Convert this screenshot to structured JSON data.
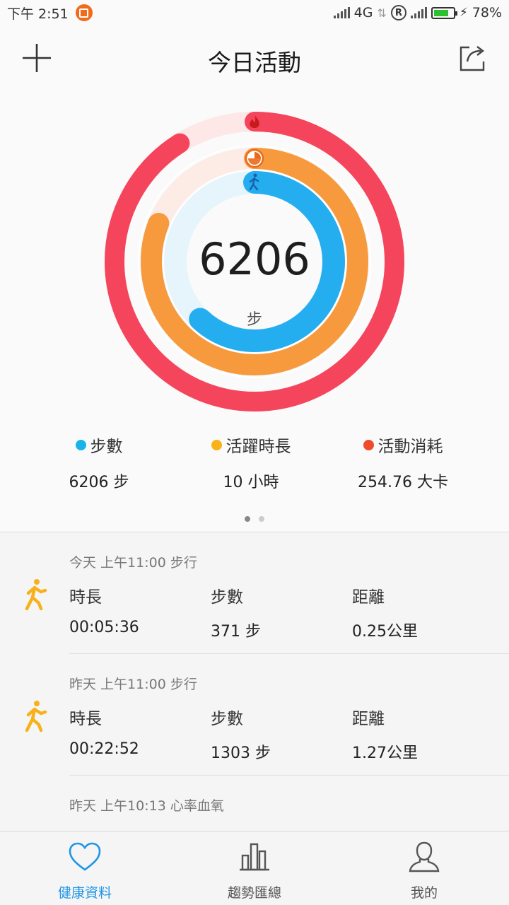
{
  "status_bar": {
    "time": "下午 2:51",
    "network": "4G",
    "battery_percent": "78%",
    "battery_level": 0.78
  },
  "header": {
    "title": "今日活動",
    "left_icon": "plus-icon",
    "right_icon": "share-icon"
  },
  "summary": {
    "center_value": "6206",
    "center_unit": "步",
    "rings": [
      {
        "name": "活動消耗",
        "color": "#f5455c",
        "progress": 0.91
      },
      {
        "name": "活躍時長",
        "color": "#f79a3e",
        "progress": 0.81
      },
      {
        "name": "步數",
        "color": "#24aef0",
        "progress": 0.62
      }
    ],
    "metrics": [
      {
        "label": "步數",
        "value": "6206  步",
        "color": "#1ab3e8"
      },
      {
        "label": "活躍時長",
        "value": "10  小時",
        "color": "#f9b218"
      },
      {
        "label": "活動消耗",
        "value": "254.76  大卡",
        "color": "#ef4c2c"
      }
    ],
    "pager": {
      "pages": 2,
      "current": 1
    }
  },
  "records": [
    {
      "header": "今天 上午11:00 步行",
      "icon": "walking-icon",
      "duration_label": "時長",
      "duration": "00:05:36",
      "steps_label": "步數",
      "steps": "371  步",
      "distance_label": "距離",
      "distance": "0.25公里"
    },
    {
      "header": "昨天 上午11:00 步行",
      "icon": "walking-icon",
      "duration_label": "時長",
      "duration": "00:22:52",
      "steps_label": "步數",
      "steps": "1303  步",
      "distance_label": "距離",
      "distance": "1.27公里"
    },
    {
      "header": "昨天 上午10:13 心率血氧",
      "icon": "heart-icon"
    }
  ],
  "tabs": [
    {
      "label": "健康資料",
      "icon": "heart-outline-icon",
      "active": true
    },
    {
      "label": "趨勢匯總",
      "icon": "bar-chart-icon",
      "active": false
    },
    {
      "label": "我的",
      "icon": "person-icon",
      "active": false
    }
  ],
  "colors": {
    "accent": "#1e96e6",
    "walk": "#f7b11a"
  }
}
